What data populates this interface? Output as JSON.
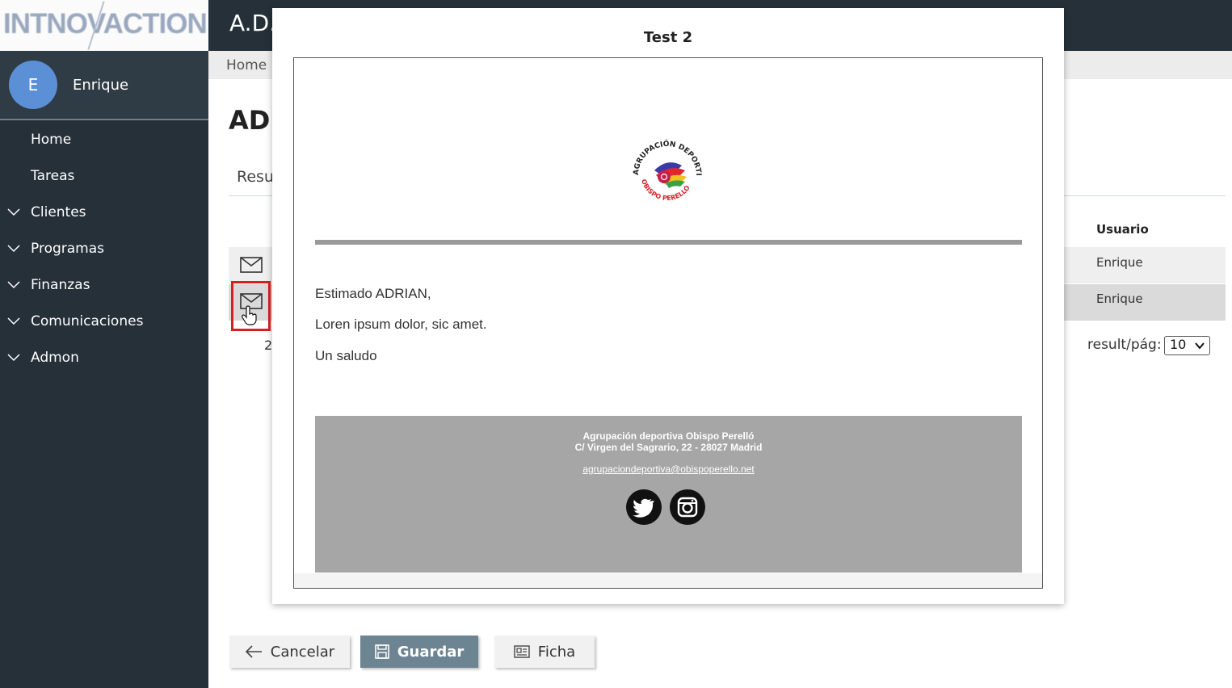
{
  "app": {
    "logo_text": "INTNOVACTION",
    "header_title": "A.D.",
    "breadcrumb": "Home"
  },
  "user": {
    "initial": "E",
    "name": "Enrique"
  },
  "sidebar": {
    "items": [
      {
        "label": "Home",
        "expandable": false
      },
      {
        "label": "Tareas",
        "expandable": false
      },
      {
        "label": "Clientes",
        "expandable": true
      },
      {
        "label": "Programas",
        "expandable": true
      },
      {
        "label": "Finanzas",
        "expandable": true
      },
      {
        "label": "Comunicaciones",
        "expandable": true
      },
      {
        "label": "Admon",
        "expandable": true
      }
    ]
  },
  "main": {
    "page_title": "ADI",
    "tab_label": "Resu",
    "column_user": "Usuario",
    "rows": [
      {
        "user": "Enrique",
        "icon": "mail-icon"
      },
      {
        "user": "Enrique",
        "icon": "mail-icon"
      }
    ],
    "pager_number": "2",
    "pager_label": "result/pág:",
    "pager_value": "10"
  },
  "buttons": {
    "cancel": "Cancelar",
    "save": "Guardar",
    "ficha": "Ficha"
  },
  "modal": {
    "title": "Test 2",
    "greeting": "Estimado ADRIAN,",
    "body": "Loren ipsum dolor, sic amet.",
    "closing": "Un saludo",
    "logo_text_top": "AGRUPACIÓN DEPORTIVA",
    "logo_text_bottom": "OBISPO PERELLÓ",
    "footer_org_prefix": "Agrupación deportiva ",
    "footer_org_name": "Obispo Perelló",
    "footer_address": "C/ Virgen del Sagrario, 22 - 28027 Madrid",
    "footer_email": "agrupaciondeportiva@obispoperello.net",
    "social": [
      "twitter-icon",
      "instagram-icon"
    ]
  },
  "colors": {
    "sidebar_bg": "#253039",
    "avatar": "#5b8fd6",
    "save_button": "#6d8592",
    "highlight": "#d9201f",
    "email_footer": "#a6a6a6"
  }
}
